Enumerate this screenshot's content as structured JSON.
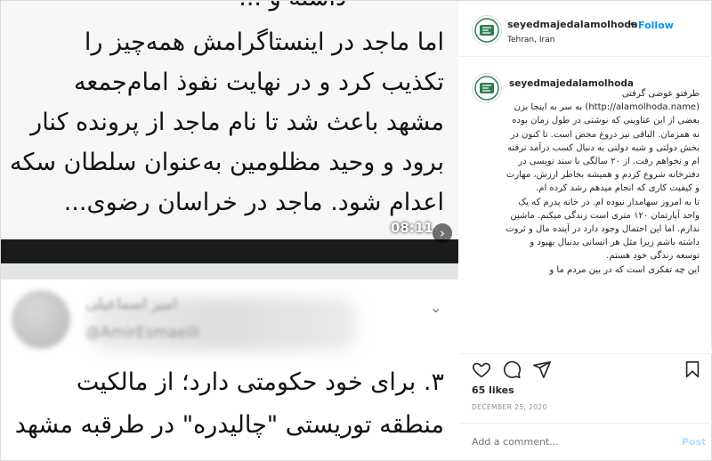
{
  "media": {
    "top_lines": [
      "داسته و ...",
      "اما ماجد در اینستاگرامش همه‌چیز را",
      "تکذیب کرد و در نهایت نفوذ امام‌جمعه",
      "مشهد باعث شد تا نام ماجد از پرونده کنار",
      "برود و وحید مظلومین به‌عنوان سلطان سکه",
      "اعدام شود. ماجد در خراسان رضوی..."
    ],
    "timer": "08:11",
    "tweet": {
      "name": "امیر اسماعیلی",
      "handle": "@AmirEsmaeili",
      "lines": [
        "۳. برای خود حکومتی دارد؛ از مالکیت",
        "منطقه توریستی \"چالیدره\" در طرقبه مشهد"
      ]
    }
  },
  "post": {
    "username": "seyedmajedalamolhoda",
    "follow_label": "Follow",
    "location": "Tehran, Iran",
    "caption_user": "seyedmajedalamolhoda",
    "caption": "طرفتو عوضی گرفتی\n(http://alamolhoda.name) به سر به اینجا بزن\nبعضی از این عناوینی که نوشتی در طول زمان بوده نه همزمان. الباقی نیز دروغ محض است. تا کنون در بخش دولتی و شبه دولتی به دنبال کسب درآمد نرفته ام و نخواهم رفت. از ۲۰ سالگی با سند نویسی در دفترخانه شروع کردم و همیشه بخاطر ارزش، مهارت و کیفیت کاری که انجام میدهم رشد کرده ام.\nتا به امروز سهامدار نبوده ام. در خانه پدرم که یک واحد آپارتمان ۱۲۰ متری است زندگی میکنم. ماشین ندارم. اما این احتمال وجود دارد در آینده مال و ثروت داشته باشم زیرا مثل هر انسانی بدنبال بهبود و توسعه زندگی خود هستم.\nاین چه تفکری است که در بین مردم ما و",
    "likes": "65 likes",
    "date": "DECEMBER 25, 2020",
    "comment_placeholder": "Add a comment...",
    "post_label": "Post"
  },
  "icons": {
    "like": "heart-icon",
    "comment": "comment-icon",
    "share": "share-icon",
    "save": "bookmark-icon",
    "timer": "chevron-right-icon"
  },
  "colors": {
    "follow": "#0095f6",
    "post_disabled": "#b2dffc",
    "logo_green": "#2e7d4f"
  }
}
